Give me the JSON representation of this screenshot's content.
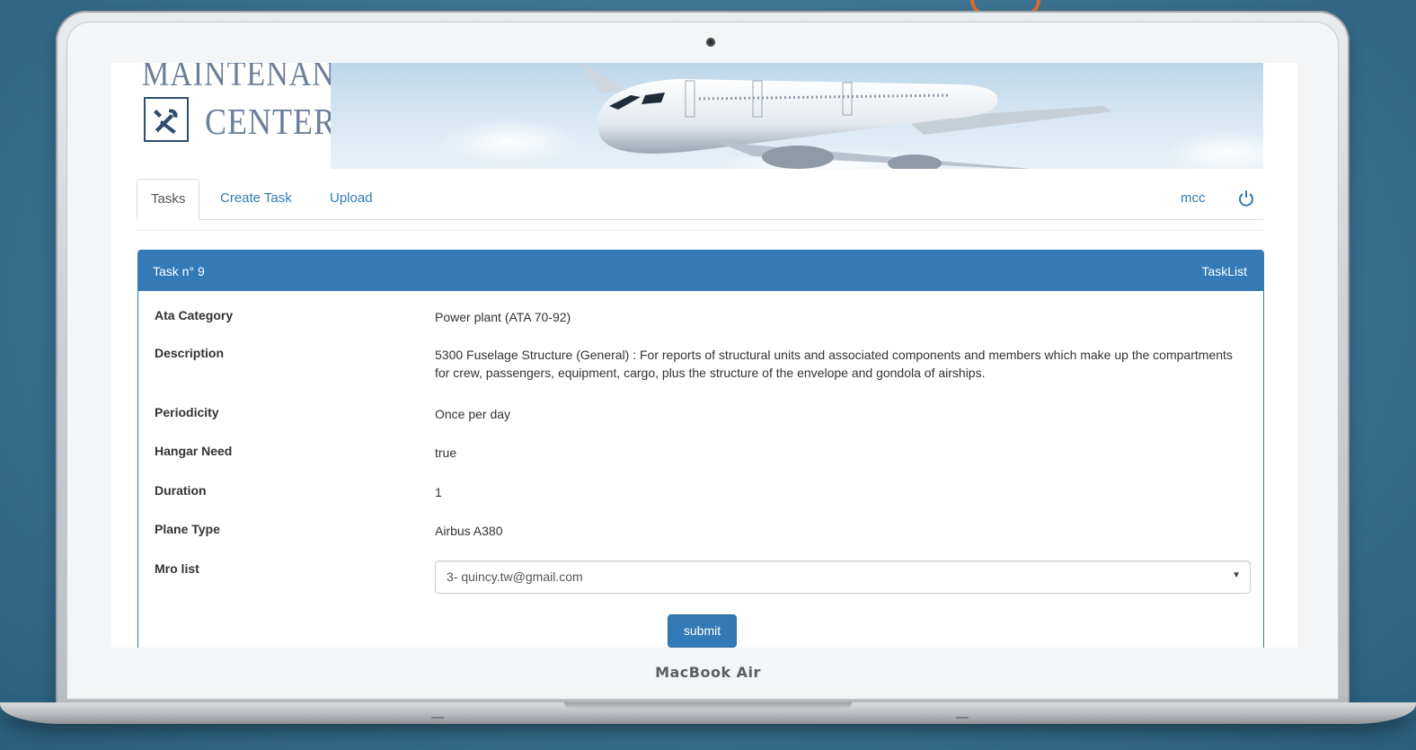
{
  "device": {
    "brand_label": "MacBook Air"
  },
  "app": {
    "logo": {
      "top_text": "MAINTENANCE",
      "bottom_text": "CENTER",
      "icon": "tools-icon"
    },
    "nav": {
      "tabs": [
        {
          "label": "Tasks",
          "active": true
        },
        {
          "label": "Create Task",
          "active": false
        },
        {
          "label": "Upload",
          "active": false
        }
      ],
      "user": "mcc",
      "logout_icon": "power-icon"
    },
    "panel": {
      "title": "Task n° 9",
      "link": "TaskList",
      "fields": {
        "ata_category": {
          "label": "Ata Category",
          "value": "Power plant (ATA 70-92)"
        },
        "description": {
          "label": "Description",
          "value": "5300 Fuselage Structure (General) : For reports of structural units and associated components and members which make up the compartments for crew, passengers, equipment, cargo, plus the structure of the envelope and gondola of airships."
        },
        "periodicity": {
          "label": "Periodicity",
          "value": "Once per day"
        },
        "hangar_need": {
          "label": "Hangar Need",
          "value": "true"
        },
        "duration": {
          "label": "Duration",
          "value": "1"
        },
        "plane_type": {
          "label": "Plane Type",
          "value": "Airbus A380"
        },
        "mro_list": {
          "label": "Mro list",
          "selected": "3- quincy.tw@gmail.com"
        }
      },
      "submit_label": "submit"
    }
  },
  "colors": {
    "primary": "#337ab7",
    "background": "#3f7896",
    "accent": "#e26a2c"
  }
}
